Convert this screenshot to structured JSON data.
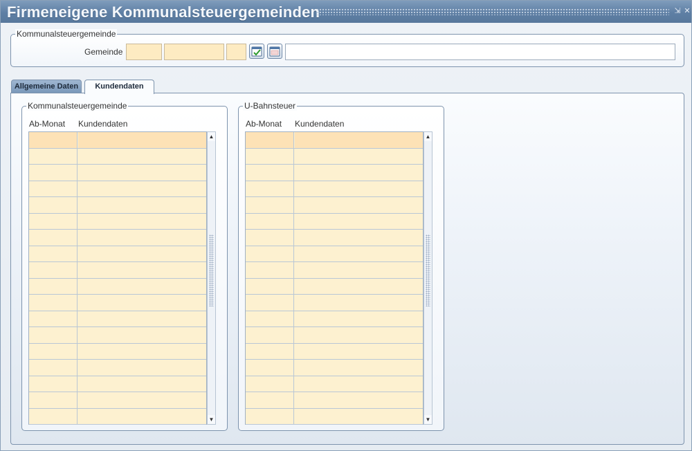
{
  "window": {
    "title": "Firmeneigene Kommunalsteuergemeinden",
    "controls": {
      "minimize": "⇲",
      "close": "✕"
    }
  },
  "header_group": {
    "legend": "Kommunalsteuergemeinde",
    "gemeinde_label": "Gemeinde",
    "fields": [
      "",
      "",
      ""
    ],
    "name_value": "",
    "icons": [
      "calendar-check-icon",
      "calendar-icon"
    ]
  },
  "tabs": [
    {
      "label": "Allgemeine Daten",
      "active": false
    },
    {
      "label": "Kundendaten",
      "active": true
    }
  ],
  "tables": [
    {
      "legend": "Kommunalsteuergemeinde",
      "columns": [
        "Ab-Monat",
        "Kundendaten"
      ],
      "rows": 18
    },
    {
      "legend": "U-Bahnsteuer",
      "columns": [
        "Ab-Monat",
        "Kundendaten"
      ],
      "rows": 18
    }
  ],
  "scrollbar": {
    "up": "▲",
    "down": "▼"
  },
  "colors": {
    "titlebar": "#5e7fa4",
    "field_fill": "#fdebc2",
    "row_fill": "#fdf1d0",
    "row_selected": "#fde2b6",
    "border": "#7d93ad"
  }
}
